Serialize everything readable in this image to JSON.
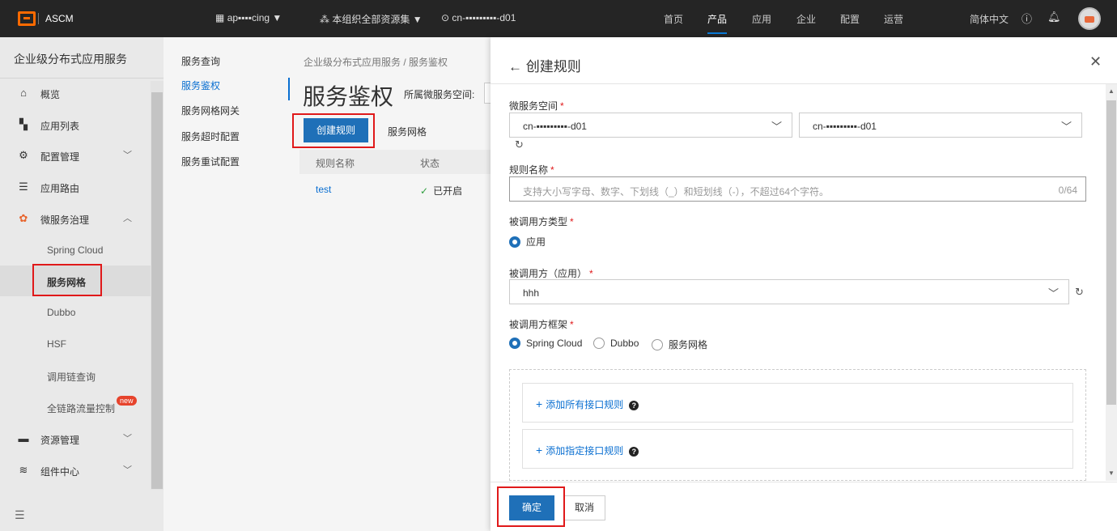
{
  "topbar": {
    "brand": "ASCM",
    "org": "ap▪▪▪▪cing",
    "resource_set": "本组织全部资源集",
    "region": "cn-▪▪▪▪▪▪▪▪▪-d01",
    "nav": [
      "首页",
      "产品",
      "应用",
      "企业",
      "配置",
      "运营"
    ],
    "nav_active": "产品",
    "language": "简体中文",
    "accent_color": "#0a7ad6"
  },
  "sidebar": {
    "title": "企业级分布式应用服务",
    "items": [
      {
        "label": "概览",
        "icon": "home-icon"
      },
      {
        "label": "应用列表",
        "icon": "grid-icon"
      },
      {
        "label": "配置管理",
        "icon": "config-icon",
        "expandable": true
      },
      {
        "label": "应用路由",
        "icon": "route-icon"
      },
      {
        "label": "微服务治理",
        "icon": "microservice-icon",
        "expanded": true
      }
    ],
    "sub_items": [
      "Spring Cloud",
      "服务网格",
      "Dubbo",
      "HSF",
      "调用链查询",
      "全链路流量控制"
    ],
    "active_sub": "服务网格",
    "new_badge": "new",
    "bottom_items": [
      {
        "label": "资源管理",
        "icon": "folder-icon"
      },
      {
        "label": "组件中心",
        "icon": "layers-icon"
      }
    ]
  },
  "subnav": {
    "items": [
      "服务查询",
      "服务鉴权",
      "服务网格网关",
      "服务超时配置",
      "服务重试配置"
    ],
    "active": "服务鉴权"
  },
  "main": {
    "breadcrumb": "企业级分布式应用服务  /  服务鉴权",
    "title": "服务鉴权",
    "namespace_label": "所属微服务空间:",
    "create_button": "创建规则",
    "tab_mesh": "服务网格",
    "table": {
      "headers": [
        "规则名称",
        "状态"
      ],
      "rows": [
        {
          "name": "test",
          "status": "已开启"
        }
      ]
    }
  },
  "panel": {
    "title": "创建规则",
    "namespace": {
      "label": "微服务空间",
      "region_value": "cn-▪▪▪▪▪▪▪▪▪-d01",
      "space_value": "cn-▪▪▪▪▪▪▪▪▪-d01"
    },
    "rule_name": {
      "label": "规则名称",
      "placeholder": "支持大小写字母、数字、下划线（_）和短划线（-），不超过64个字符。",
      "counter": "0/64"
    },
    "callee_type": {
      "label": "被调用方类型",
      "option": "应用"
    },
    "callee_app": {
      "label": "被调用方（应用）",
      "value": "hhh"
    },
    "callee_framework": {
      "label": "被调用方框架",
      "options": [
        "Spring Cloud",
        "Dubbo",
        "服务网格"
      ],
      "selected": "Spring Cloud"
    },
    "add_all_rule": "添加所有接口规则",
    "add_specific_rule": "添加指定接口规则",
    "confirm": "确定",
    "cancel": "取消"
  }
}
